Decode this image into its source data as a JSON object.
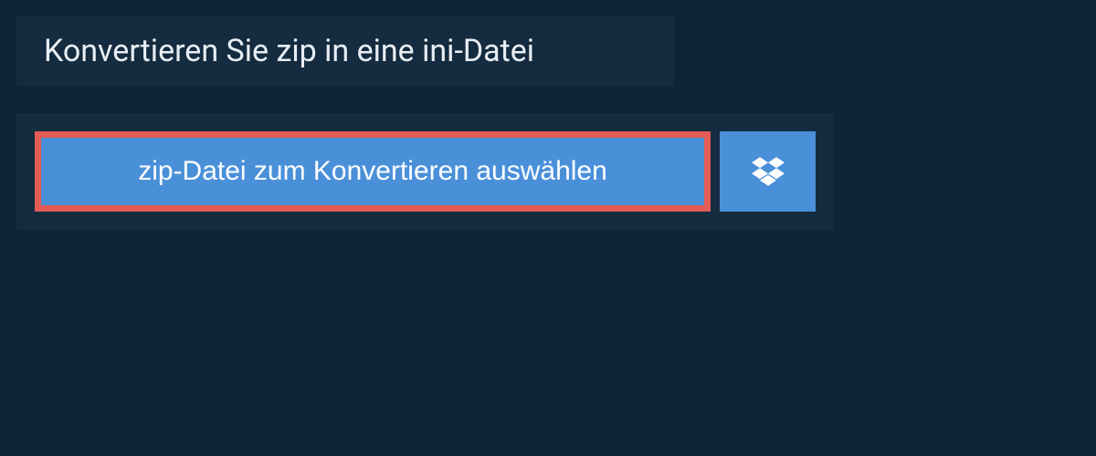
{
  "header": {
    "title": "Konvertieren Sie zip in eine ini-Datei"
  },
  "upload": {
    "select_file_label": "zip-Datei zum Konvertieren auswählen"
  },
  "colors": {
    "background": "#0d2438",
    "panel": "#152b3f",
    "button_primary": "#4a90d9",
    "button_border": "#e35c56",
    "text_light": "#e8eef4"
  }
}
